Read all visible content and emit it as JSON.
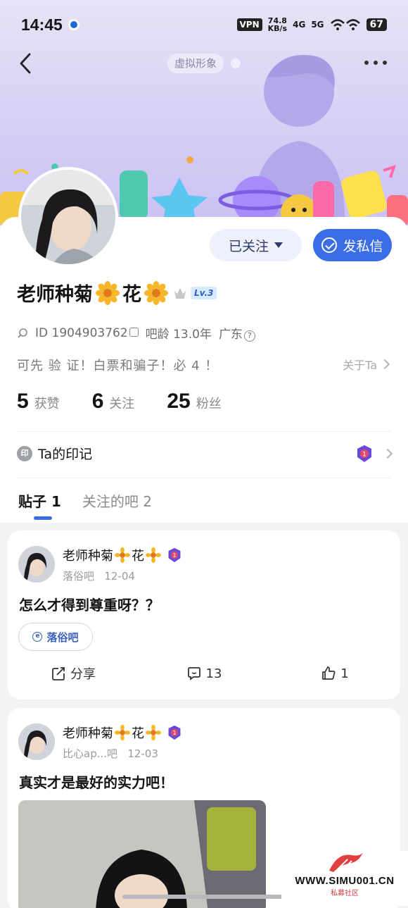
{
  "status_bar": {
    "time": "14:45",
    "vpn": "VPN",
    "speed_value": "74.8",
    "speed_unit": "KB/s",
    "signal_1": "4G",
    "signal_2": "5G",
    "battery": "67"
  },
  "header": {
    "virtual_chip": "虚拟形象"
  },
  "profile": {
    "name_part1": "老师种菊",
    "name_part2": "花",
    "level": "Lv.3",
    "id_text": "ID 1904903762",
    "bar_age": "吧龄 13.0年",
    "location": "广东",
    "bio": "可先 验 证！白票和骗子！必 4  ！",
    "about_label": "关于Ta",
    "follow_button": "已关注",
    "message_button": "发私信"
  },
  "stats": [
    {
      "value": "5",
      "label": "获赞"
    },
    {
      "value": "6",
      "label": "关注"
    },
    {
      "value": "25",
      "label": "粉丝"
    }
  ],
  "mark": {
    "icon_text": "印",
    "label": "Ta的印记"
  },
  "tabs": [
    {
      "label": "贴子",
      "count": "1",
      "active": true
    },
    {
      "label": "关注的吧",
      "count": "2",
      "active": false
    }
  ],
  "posts": [
    {
      "author_part1": "老师种菊",
      "author_part2": "花",
      "forum": "落俗吧",
      "date": "12-04",
      "title": "怎么才得到尊重呀？？",
      "tag": "落俗吧",
      "share_label": "分享",
      "comments": "13",
      "likes": "1"
    },
    {
      "author_part1": "老师种菊",
      "author_part2": "花",
      "forum": "比心ap...吧",
      "date": "12-03",
      "title": "真实才是最好的实力吧！"
    }
  ],
  "watermark": {
    "url": "WWW.SIMU001.CN",
    "sub": "私募社区"
  },
  "colors": {
    "accent": "#3b6ee6",
    "banner": "#d9d3f5",
    "follow_bg": "#eef0fb"
  }
}
